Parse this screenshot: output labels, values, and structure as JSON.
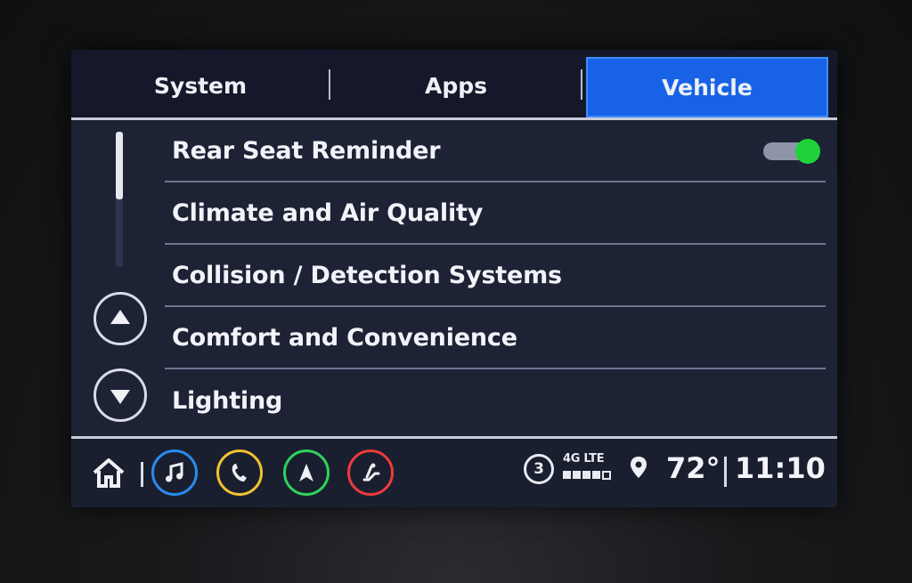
{
  "tabs": [
    {
      "label": "System",
      "active": false
    },
    {
      "label": "Apps",
      "active": false
    },
    {
      "label": "Vehicle",
      "active": true
    }
  ],
  "menu": {
    "items": [
      {
        "label": "Rear Seat Reminder",
        "toggle": true,
        "toggle_on": true
      },
      {
        "label": "Climate and Air Quality"
      },
      {
        "label": "Collision / Detection Systems"
      },
      {
        "label": "Comfort and Convenience"
      },
      {
        "label": "Lighting"
      }
    ],
    "scroll_position_fraction": 0.5
  },
  "bottom_bar": {
    "apps": [
      {
        "name": "home-icon"
      },
      {
        "name": "music-icon",
        "color": "#2a8cf0"
      },
      {
        "name": "phone-icon",
        "color": "#f2c230"
      },
      {
        "name": "navigation-icon",
        "color": "#2fd25a"
      },
      {
        "name": "seat-icon",
        "color": "#ef3b3b"
      }
    ],
    "notification_count": "3",
    "network": "4G LTE",
    "signal_bars": 4,
    "signal_bars_total": 5,
    "temperature": "72°",
    "time": "11:10"
  },
  "colors": {
    "active_tab": "#1762e6",
    "toggle_on": "#20d23a",
    "background": "#1d2235"
  }
}
